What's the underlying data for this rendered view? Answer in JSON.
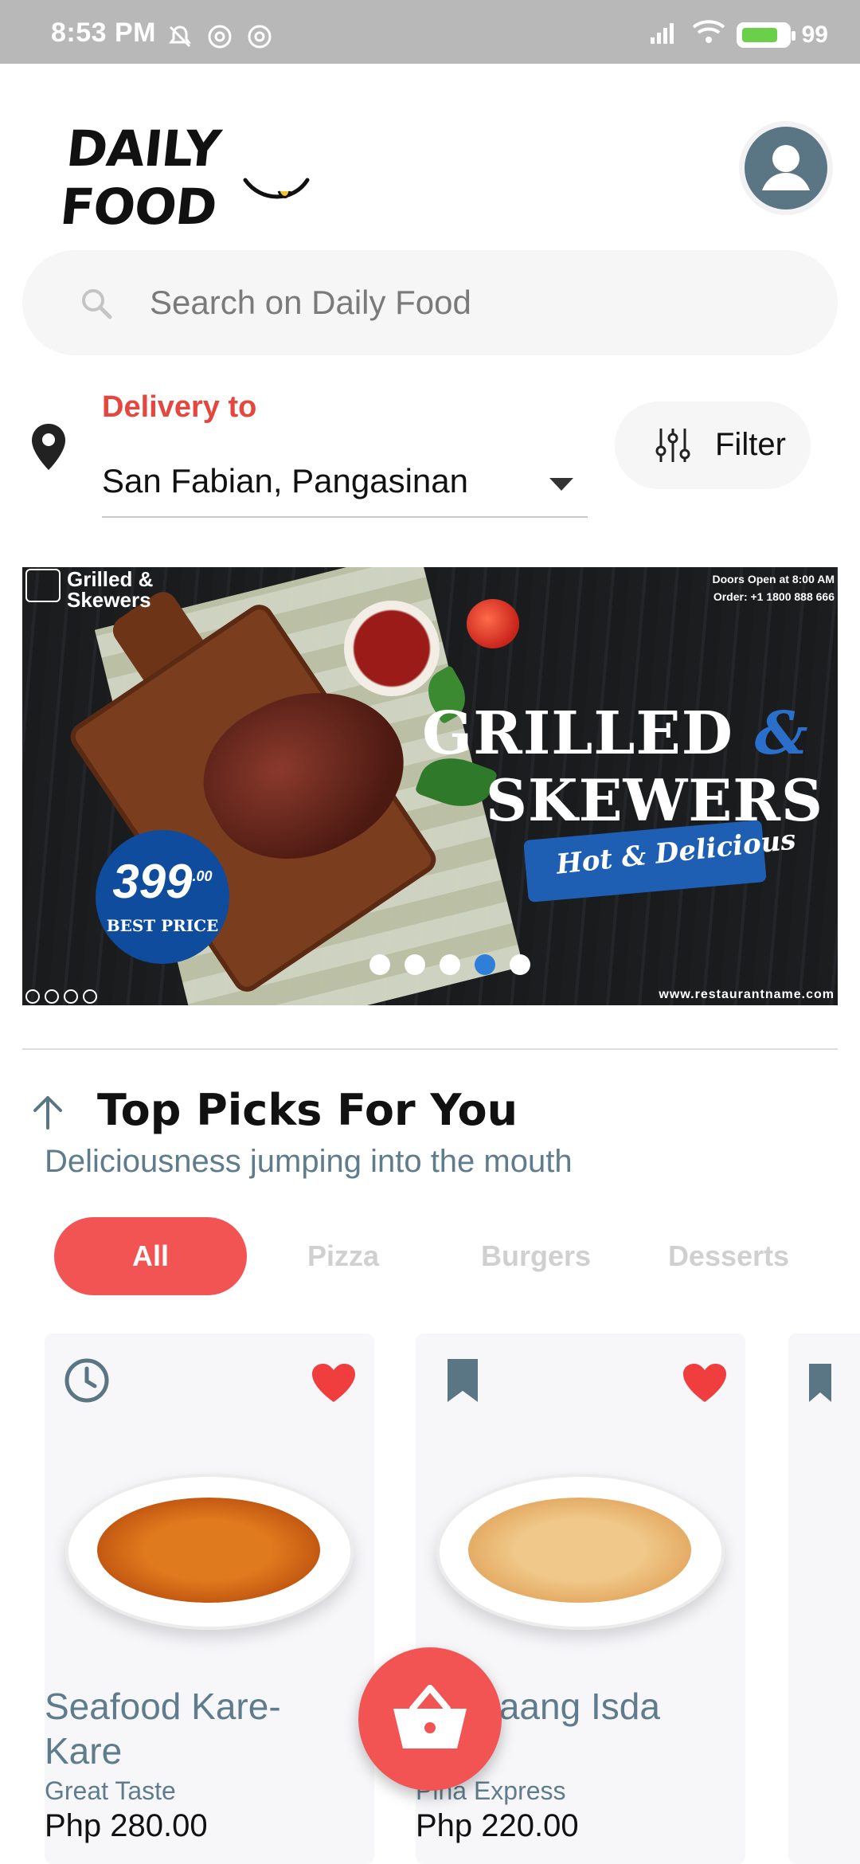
{
  "status_bar": {
    "time": "8:53 PM",
    "battery": "99"
  },
  "header": {
    "logo_text": "DAILY FOOD"
  },
  "search": {
    "placeholder": "Search on Daily Food"
  },
  "delivery": {
    "label": "Delivery to",
    "location": "San Fabian, Pangasinan",
    "filter_label": "Filter"
  },
  "banner": {
    "brand": "Grilled & Skewers",
    "info_line1": "Doors Open at 8:00 AM",
    "info_line2": "Order: +1 1800 888 666",
    "title_line1": "GRILLED",
    "title_amp": "&",
    "title_line2": "SKEWERS",
    "tagline": "Hot & Delicious",
    "price": "399",
    "price_cents": ".00",
    "price_label": "BEST PRICE",
    "url": "www.restaurantname.com",
    "slides": 5,
    "active_slide": 4
  },
  "section": {
    "title": "Top Picks For You",
    "subtitle": "Deliciousness jumping into the mouth"
  },
  "categories": [
    {
      "label": "All",
      "active": true
    },
    {
      "label": "Pizza",
      "active": false
    },
    {
      "label": "Burgers",
      "active": false
    },
    {
      "label": "Desserts",
      "active": false
    }
  ],
  "cards": [
    {
      "name": "Seafood Kare-Kare",
      "store": "Great Taste",
      "price": "Php 280.00",
      "left_icon": "clock-icon",
      "right_icon": "heart-icon"
    },
    {
      "name": "Pinataang Isda",
      "store": "Pina Express",
      "price": "Php 220.00",
      "left_icon": "bookmark-icon",
      "right_icon": "heart-icon"
    }
  ],
  "colors": {
    "accent": "#f25353",
    "label_red": "#e5473e",
    "muted_text": "#5f7c8c",
    "banner_blue": "#1f5fb3"
  }
}
